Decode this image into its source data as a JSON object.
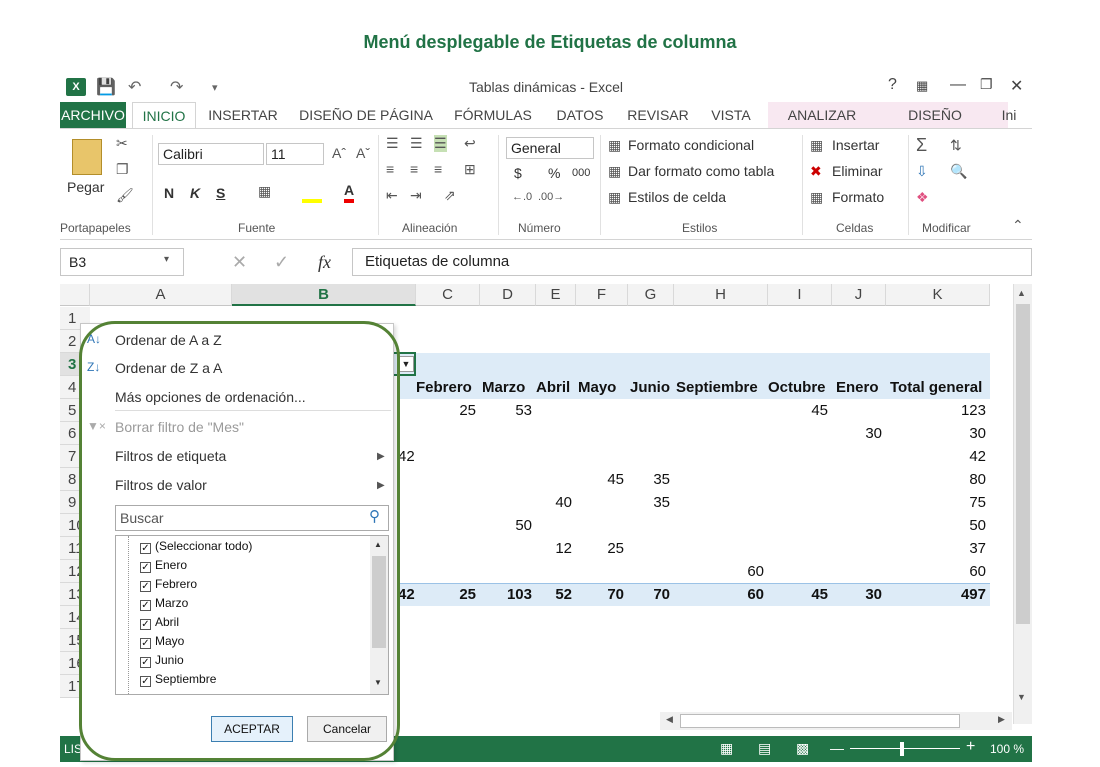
{
  "caption": "Menú desplegable de Etiquetas de columna",
  "window_title": "Tablas dinámicas - Excel",
  "tabs": [
    "ARCHIVO",
    "INICIO",
    "INSERTAR",
    "DISEÑO DE PÁGINA",
    "FÓRMULAS",
    "DATOS",
    "REVISAR",
    "VISTA",
    "ANALIZAR",
    "DISEÑO",
    "Ini"
  ],
  "ribbon": {
    "paste_label": "Pegar",
    "font_name": "Calibri",
    "font_size": "11",
    "bold": "N",
    "italic": "K",
    "underline": "S",
    "number_format": "General",
    "currency": "$",
    "percent": "%",
    "thousands": "000",
    "cond_format": "Formato condicional",
    "table_format": "Dar formato como tabla",
    "cell_styles": "Estilos de celda",
    "insert": "Insertar",
    "delete": "Eliminar",
    "format": "Formato",
    "groups": [
      "Portapapeles",
      "Fuente",
      "Alineación",
      "Número",
      "Estilos",
      "Celdas",
      "Modificar"
    ]
  },
  "formula_bar": {
    "name_box": "B3",
    "fx": "fx",
    "content": "Etiquetas de columna"
  },
  "columns": [
    "A",
    "B",
    "C",
    "D",
    "E",
    "F",
    "G",
    "H",
    "I",
    "J",
    "K"
  ],
  "rows": [
    "1",
    "2",
    "3",
    "4",
    "5",
    "6",
    "7",
    "8",
    "9",
    "10",
    "11",
    "12",
    "13",
    "14",
    "15",
    "16",
    "17"
  ],
  "pivot": {
    "headers": [
      "Febrero",
      "Marzo",
      "Abril",
      "Mayo",
      "Junio",
      "Septiembre",
      "Octubre",
      "Enero",
      "Total general"
    ],
    "row5": [
      "25",
      "53",
      "",
      "",
      "",
      "",
      "45",
      "",
      "123"
    ],
    "row6": [
      "",
      "",
      "",
      "",
      "",
      "",
      "",
      "30",
      "30"
    ],
    "row7": [
      "",
      "",
      "",
      "",
      "",
      "",
      "",
      "",
      "42"
    ],
    "row8": [
      "",
      "",
      "",
      "45",
      "35",
      "",
      "",
      "",
      "80"
    ],
    "row9": [
      "",
      "",
      "40",
      "",
      "35",
      "",
      "",
      "",
      "75"
    ],
    "row10": [
      "",
      "50",
      "",
      "",
      "",
      "",
      "",
      "",
      "50"
    ],
    "row11": [
      "",
      "",
      "12",
      "25",
      "",
      "",
      "",
      "",
      "37"
    ],
    "row12": [
      "",
      "",
      "",
      "",
      "",
      "60",
      "",
      "",
      "60"
    ],
    "totals": [
      "25",
      "103",
      "52",
      "70",
      "70",
      "60",
      "45",
      "30",
      "497"
    ],
    "partial_7": "42",
    "partial_13": "42"
  },
  "menu": {
    "sort_az": "Ordenar de A a Z",
    "sort_za": "Ordenar de Z a A",
    "more_sort": "Más opciones de ordenación...",
    "clear_filter": "Borrar filtro de \"Mes\"",
    "label_filters": "Filtros de etiqueta",
    "value_filters": "Filtros de valor",
    "search_placeholder": "Buscar",
    "items": [
      "(Seleccionar todo)",
      "Enero",
      "Febrero",
      "Marzo",
      "Abril",
      "Mayo",
      "Junio",
      "Septiembre"
    ],
    "ok": "ACEPTAR",
    "cancel": "Cancelar"
  },
  "status": {
    "left": "LIS",
    "zoom": "100 %"
  },
  "colors": {
    "excel_green": "#217346",
    "highlight_ring": "#548235",
    "pivot_blue": "#ddebf7"
  }
}
